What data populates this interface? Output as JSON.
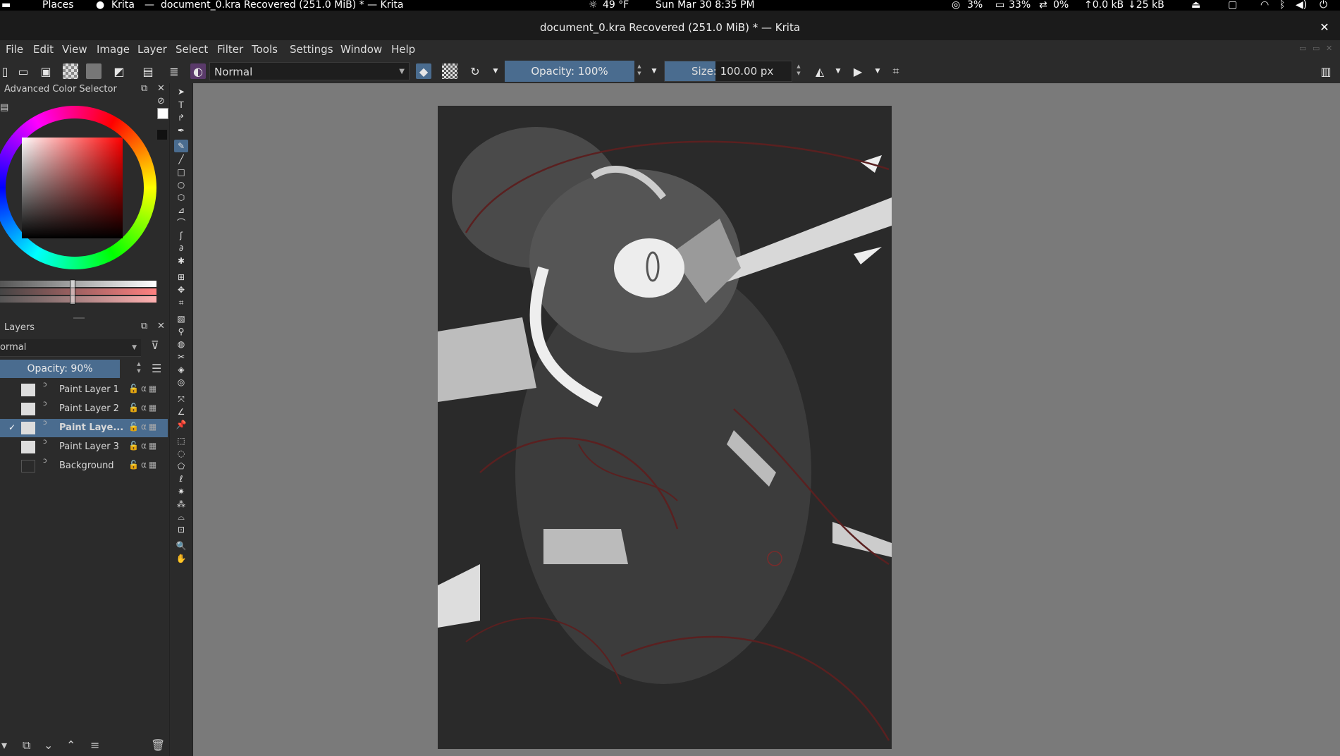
{
  "system_bar": {
    "places": "Places",
    "app": "Krita",
    "window_title": "document_0.kra Recovered (251.0 MiB) * — Krita",
    "weather": "49 °F",
    "datetime": "Sun Mar 30    8:35 PM",
    "cpu": "3%",
    "memory": "33%",
    "swap": "0%",
    "upload": "↑0.0 kB",
    "download": "↓25 kB"
  },
  "titlebar": {
    "title": "document_0.kra Recovered (251.0 MiB) * — Krita",
    "close": "✕"
  },
  "menu": {
    "items": [
      {
        "label": "File"
      },
      {
        "label": "Edit"
      },
      {
        "label": "View"
      },
      {
        "label": "Image"
      },
      {
        "label": "Layer"
      },
      {
        "label": "Select"
      },
      {
        "label": "Filter"
      },
      {
        "label": "Tools"
      },
      {
        "label": "Settings"
      },
      {
        "label": "Window"
      },
      {
        "label": "Help"
      }
    ]
  },
  "toolbar": {
    "blend_mode": "Normal",
    "opacity": "Opacity: 100%",
    "size_label": "Size:",
    "size_value": "100.00 px"
  },
  "color_selector": {
    "title": "Advanced Color Selector",
    "fg_color": "#ffffff",
    "bg_color": "#111111"
  },
  "layers": {
    "title": "Layers",
    "blend_mode": "ormal",
    "opacity": "Opacity:  90%",
    "rows": [
      {
        "name": "Paint Layer 1",
        "checked": "",
        "thumb": "light"
      },
      {
        "name": "Paint Layer 2",
        "checked": "",
        "thumb": "light"
      },
      {
        "name": "Paint Laye...",
        "checked": "✓",
        "thumb": "light"
      },
      {
        "name": "Paint Layer 3",
        "checked": "",
        "thumb": "light"
      },
      {
        "name": "Background",
        "checked": "",
        "thumb": "dark"
      }
    ]
  },
  "colors": {
    "accent": "#4a6c8f",
    "canvas_bg": "#7a7a7a",
    "panel_bg": "#2b2b2b"
  }
}
